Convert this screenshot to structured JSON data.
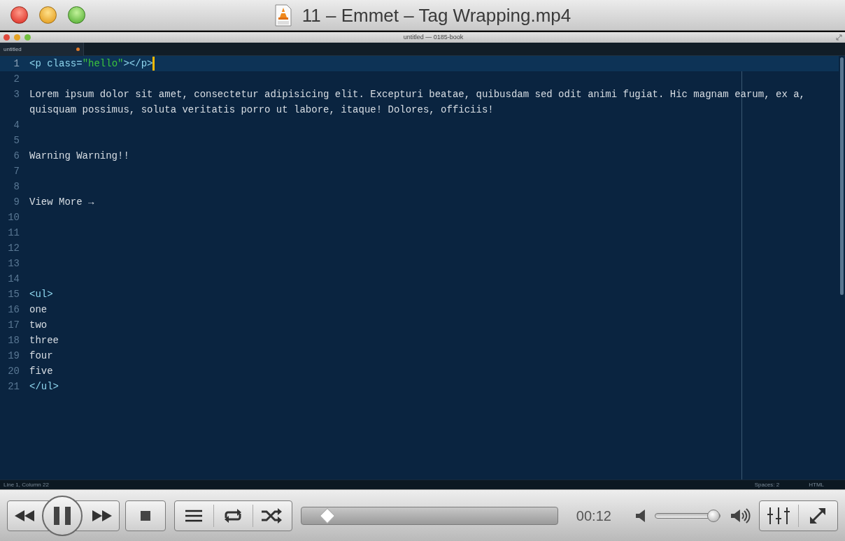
{
  "window": {
    "title": "11 – Emmet – Tag Wrapping.mp4"
  },
  "video": {
    "editor_title": "untitled — 0185-book",
    "tabs": [
      {
        "label": "untitled",
        "selected": true,
        "modified": true
      }
    ],
    "lines": [
      {
        "number": "1",
        "current": true,
        "tokens": [
          {
            "kind": "tag",
            "text": "<p "
          },
          {
            "kind": "attr",
            "text": "class="
          },
          {
            "kind": "string",
            "text": "\"hello\""
          },
          {
            "kind": "tag",
            "text": "></p>"
          }
        ]
      },
      {
        "number": "2",
        "current": false
      },
      {
        "number": "3",
        "current": false,
        "tokens": [
          {
            "kind": "text",
            "text": "Lorem ipsum dolor sit amet, consectetur adipisicing elit. Excepturi beatae, quibusdam sed odit animi fugiat. Hic magnam earum, ex a, quisquam possimus, soluta veritatis porro ut labore, itaque! Dolores, officiis!"
          }
        ]
      },
      {
        "number": "4",
        "current": false
      },
      {
        "number": "5",
        "current": false
      },
      {
        "number": "6",
        "current": false,
        "tokens": [
          {
            "kind": "text",
            "text": "Warning Warning!!"
          }
        ]
      },
      {
        "number": "7",
        "current": false
      },
      {
        "number": "8",
        "current": false
      },
      {
        "number": "9",
        "current": false,
        "tokens": [
          {
            "kind": "text",
            "text": "View More →"
          }
        ]
      },
      {
        "number": "10",
        "current": false
      },
      {
        "number": "11",
        "current": false
      },
      {
        "number": "12",
        "current": false
      },
      {
        "number": "13",
        "current": false
      },
      {
        "number": "14",
        "current": false
      },
      {
        "number": "15",
        "current": false,
        "tokens": [
          {
            "kind": "tag",
            "text": "<ul>"
          }
        ]
      },
      {
        "number": "16",
        "current": false,
        "tokens": [
          {
            "kind": "text",
            "text": "one"
          }
        ]
      },
      {
        "number": "17",
        "current": false,
        "tokens": [
          {
            "kind": "text",
            "text": "two"
          }
        ]
      },
      {
        "number": "18",
        "current": false,
        "tokens": [
          {
            "kind": "text",
            "text": "three"
          }
        ]
      },
      {
        "number": "19",
        "current": false,
        "tokens": [
          {
            "kind": "text",
            "text": "four"
          }
        ]
      },
      {
        "number": "20",
        "current": false,
        "tokens": [
          {
            "kind": "text",
            "text": "five"
          }
        ]
      },
      {
        "number": "21",
        "current": false,
        "tokens": [
          {
            "kind": "tag",
            "text": "</ul>"
          }
        ]
      }
    ],
    "status_bar": {
      "position": "Line 1, Column 22",
      "indentation": "Spaces: 2",
      "syntax": "HTML"
    }
  },
  "controls": {
    "playing": true,
    "seek": {
      "level": 0.1
    },
    "time": "00:12",
    "volume": {
      "level": 0.92
    }
  }
}
